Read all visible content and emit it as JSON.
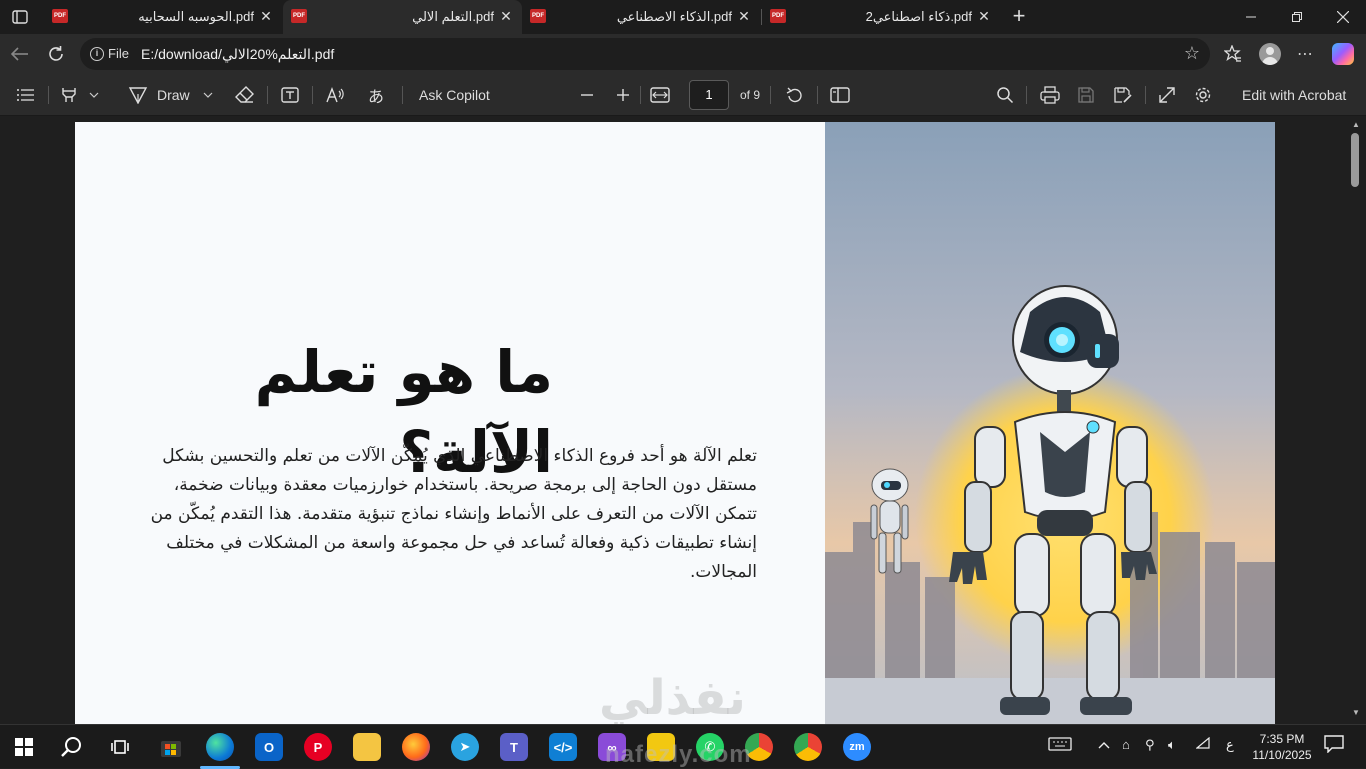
{
  "tabs": [
    {
      "title": "الحوسبه السحابيه.pdf"
    },
    {
      "title": "التعلم الالي.pdf"
    },
    {
      "title": "الذكاء الاصطناعي.pdf"
    },
    {
      "title": "ذكاء اصطناعي2.pdf"
    }
  ],
  "address": {
    "scheme": "File",
    "url": "E:/download/التعلم%20الالي.pdf"
  },
  "toolbar": {
    "draw_label": "Draw",
    "ask_copilot_label": "Ask Copilot",
    "page_number": "1",
    "page_total": "of 9",
    "edit_acrobat_label": "Edit with Acrobat"
  },
  "slide": {
    "title": "ما هو تعلم الآلة؟",
    "body": "تعلم الآلة هو أحد فروع الذكاء الاصطناعي الذي يُمكّن الآلات من تعلم والتحسين بشكل مستقل دون الحاجة إلى برمجة صريحة. باستخدام خوارزميات معقدة وبيانات ضخمة، تتمكن الآلات من التعرف على الأنماط وإنشاء نماذج تنبؤية متقدمة. هذا التقدم يُمكّن من إنشاء تطبيقات ذكية وفعالة تُساعد في حل مجموعة واسعة من المشكلات في مختلف المجالات.",
    "watermark": "نفذلي"
  },
  "taskbar": {
    "apps": [
      "Start",
      "Search",
      "Task View",
      "Microsoft Store",
      "Edge",
      "Outlook",
      "Pinterest",
      "File Explorer",
      "Firefox",
      "Telegram",
      "Teams",
      "VS Code",
      "Visual Studio",
      "Sticky Notes",
      "WhatsApp",
      "Chrome",
      "Chrome",
      "Zoom"
    ],
    "watermark": "nafezly.com",
    "input_indicator": "ع",
    "time": "7:35 PM",
    "date": "11/10/2025"
  }
}
